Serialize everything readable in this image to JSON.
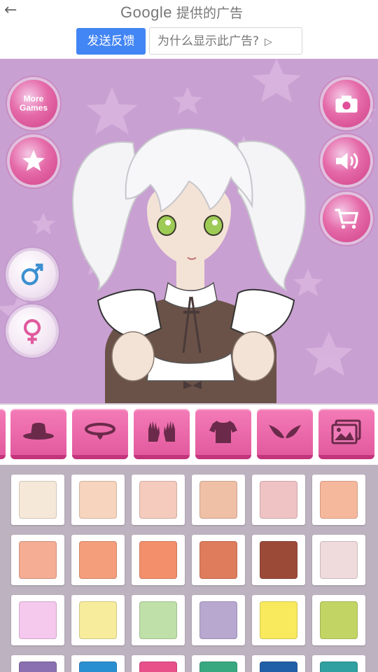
{
  "ad": {
    "brand": "Google",
    "provided_by": "提供的广告",
    "feedback_label": "发送反馈",
    "why_label": "为什么显示此广告?",
    "back_icon": "back-arrow-icon",
    "why_icon": "play-triangle-icon"
  },
  "stage": {
    "background_color": "#c9a0d2",
    "buttons": {
      "more_games_line1": "More",
      "more_games_line2": "Games"
    }
  },
  "tabs": [
    {
      "name": "hats",
      "icon": "hat-icon"
    },
    {
      "name": "collars",
      "icon": "collar-icon"
    },
    {
      "name": "gloves",
      "icon": "gloves-icon"
    },
    {
      "name": "tops",
      "icon": "shirt-icon"
    },
    {
      "name": "wings",
      "icon": "wings-icon"
    },
    {
      "name": "backgrounds",
      "icon": "picture-icon"
    }
  ],
  "palette": {
    "colors": [
      "#f6e8d8",
      "#f6d4bd",
      "#f5cbbd",
      "#efc0a6",
      "#efc3c4",
      "#f6b89c",
      "#f5ad93",
      "#f49e7c",
      "#f38f6a",
      "#de7c5b",
      "#9c4a38",
      "#efdadc",
      "#f5c8ee",
      "#f6ec9c",
      "#bfe0a8",
      "#b8a8d0",
      "#f8ea5c",
      "#c2d564",
      "#8a70b0",
      "#2a8fd0",
      "#e8508a",
      "#38a880",
      "#2060a8",
      "#30a0a0"
    ]
  }
}
